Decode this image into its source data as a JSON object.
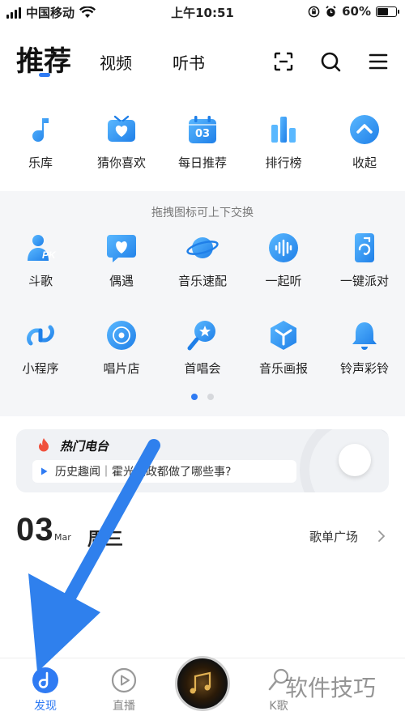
{
  "status_bar": {
    "carrier": "中国移动",
    "time": "上午10:51",
    "battery_text": "60%",
    "battery_level": 0.6
  },
  "header": {
    "tabs": [
      {
        "label": "推荐",
        "active": true
      },
      {
        "label": "视频",
        "active": false
      },
      {
        "label": "听书",
        "active": false
      }
    ],
    "icons": [
      "scan-icon",
      "search-icon",
      "menu-icon"
    ]
  },
  "quick_row": [
    {
      "label": "乐库",
      "icon": "music-note-icon"
    },
    {
      "label": "猜你喜欢",
      "icon": "heart-tv-icon"
    },
    {
      "label": "每日推荐",
      "icon": "calendar-icon",
      "badge": "03"
    },
    {
      "label": "排行榜",
      "icon": "bar-chart-icon"
    },
    {
      "label": "收起",
      "icon": "chevron-up-icon"
    }
  ],
  "panel": {
    "hint": "拖拽图标可上下交换",
    "row1": [
      {
        "label": "斗歌",
        "icon": "pk-icon"
      },
      {
        "label": "偶遇",
        "icon": "heart-bubble-icon"
      },
      {
        "label": "音乐速配",
        "icon": "planet-icon"
      },
      {
        "label": "一起听",
        "icon": "waveform-icon"
      },
      {
        "label": "一键派对",
        "icon": "party-icon"
      }
    ],
    "row2": [
      {
        "label": "小程序",
        "icon": "mini-program-icon"
      },
      {
        "label": "唱片店",
        "icon": "record-icon"
      },
      {
        "label": "首唱会",
        "icon": "mic-star-icon"
      },
      {
        "label": "音乐画报",
        "icon": "cube-icon"
      },
      {
        "label": "铃声彩铃",
        "icon": "bell-icon"
      }
    ],
    "pages": 2,
    "current_page": 1
  },
  "radio": {
    "title": "热门电台",
    "item": "历史趣闻｜霍光辅政都做了哪些事?"
  },
  "date": {
    "day": "03",
    "month": "Mar",
    "weekday": "周三",
    "playlist_link": "歌单广场"
  },
  "bottom_nav": [
    {
      "label": "发现",
      "active": true
    },
    {
      "label": "直播",
      "active": false
    },
    {
      "label": "K歌",
      "active": false
    }
  ],
  "watermark": "软件技巧",
  "colors": {
    "accent": "#2f7bf3",
    "icon_blue": "#2a8cf0",
    "panel_bg": "#f5f6f8",
    "fire": "#f0503c"
  }
}
